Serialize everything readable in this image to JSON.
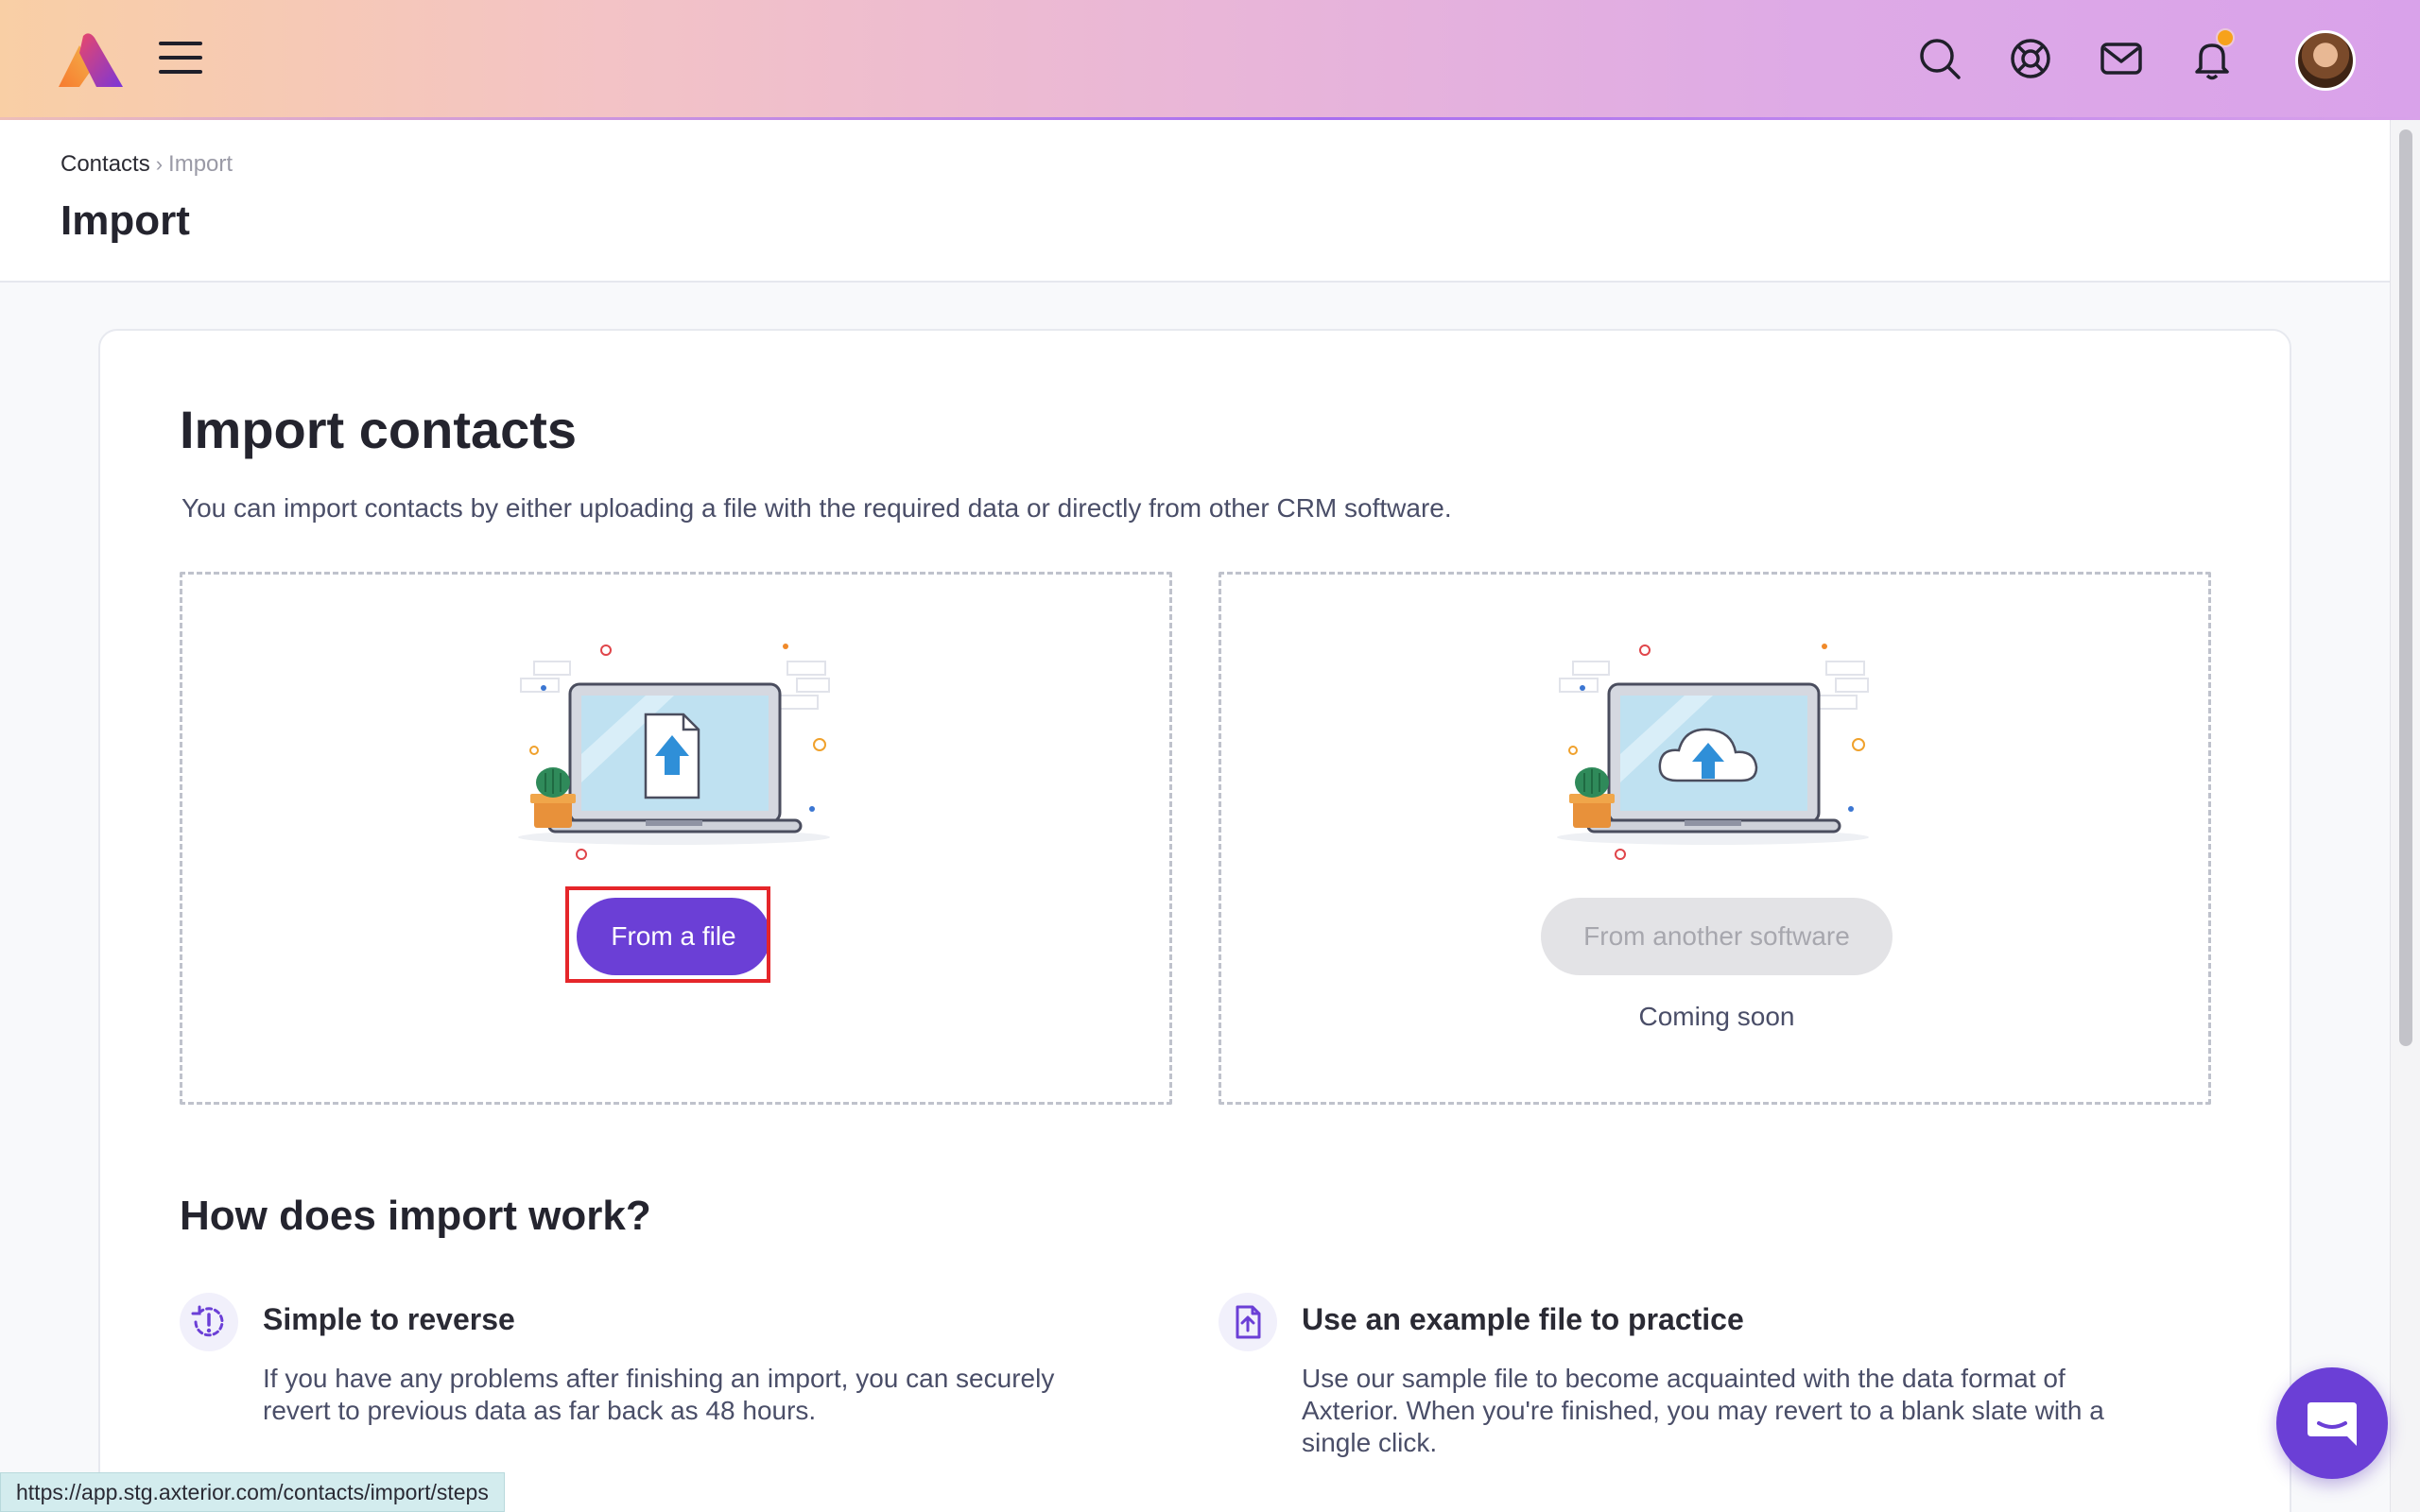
{
  "topbar": {
    "icons": [
      "logo-icon",
      "menu-icon",
      "search-icon",
      "help-icon",
      "mail-icon",
      "bell-icon",
      "avatar"
    ],
    "brand_gradient": [
      "#f9cfa5",
      "#d9a2ea"
    ],
    "notification_dot_color": "#f7a21b"
  },
  "breadcrumb": {
    "parent": "Contacts",
    "separator": "›",
    "current": "Import"
  },
  "page": {
    "title": "Import"
  },
  "card": {
    "title": "Import contacts",
    "description": "You can import contacts by either uploading a file with the required data or directly from other CRM software.",
    "options": {
      "file": {
        "button_label": "From a file",
        "icon": "file-upload-illustration"
      },
      "software": {
        "button_label": "From another software",
        "note": "Coming soon",
        "icon": "cloud-upload-illustration"
      }
    },
    "how_title": "How does import work?",
    "features": [
      {
        "title": "Simple to reverse",
        "description": "If you have any problems after finishing an import, you can securely revert to previous data as far back as 48 hours.",
        "icon": "alert-reverse-icon"
      },
      {
        "title": "Use an example file to practice",
        "description": "Use our sample file to become acquainted with the data format of Axterior. When you're finished, you may revert to a blank slate with a single click.",
        "icon": "file-upload-icon"
      }
    ]
  },
  "status_bar": {
    "url": "https://app.stg.axterior.com/contacts/import/steps"
  },
  "colors": {
    "primary": "#6b3fd6",
    "highlight": "#e5262a",
    "disabled_bg": "#e3e3e6"
  }
}
